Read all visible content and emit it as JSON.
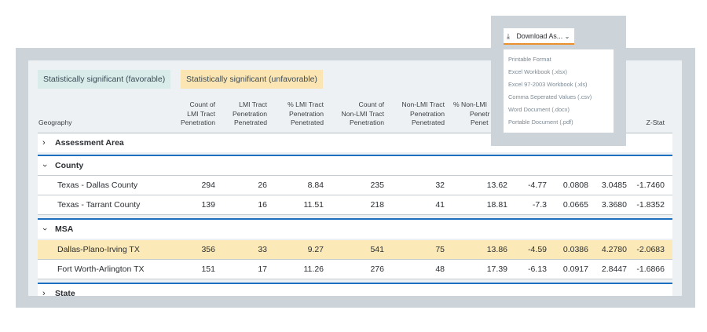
{
  "legend": {
    "favorable": "Statistically significant (favorable)",
    "unfavorable": "Statistically significant (unfavorable)"
  },
  "columns": {
    "geography": "Geography",
    "count_lmi": [
      "Count of",
      "LMI Tract",
      "Penetration"
    ],
    "lmi_penetrated": [
      "LMI Tract",
      "Penetration",
      "Penetrated"
    ],
    "pct_lmi": [
      "% LMI Tract",
      "Penetration",
      "Penetrated"
    ],
    "count_nonlmi": [
      "Count of",
      "Non-LMI Tract",
      "Penetration"
    ],
    "nonlmi_penetrated": [
      "Non-LMI Tract",
      "Penetration",
      "Penetrated"
    ],
    "pct_nonlmi": [
      "% Non-LMI",
      "Penetr",
      "Penet"
    ],
    "zstat": "Z-Stat"
  },
  "groups": {
    "assessment": "Assessment Area",
    "county": "County",
    "msa": "MSA",
    "state": "State"
  },
  "rows": {
    "dallas_county": [
      "Texas - Dallas County",
      "294",
      "26",
      "8.84",
      "235",
      "32",
      "13.62",
      "-4.77",
      "0.0808",
      "3.0485",
      "-1.7460"
    ],
    "tarrant_county": [
      "Texas - Tarrant County",
      "139",
      "16",
      "11.51",
      "218",
      "41",
      "18.81",
      "-7.3",
      "0.0665",
      "3.3680",
      "-1.8352"
    ],
    "dallas_msa": [
      "Dallas-Plano-Irving TX",
      "356",
      "33",
      "9.27",
      "541",
      "75",
      "13.86",
      "-4.59",
      "0.0386",
      "4.2780",
      "-2.0683"
    ],
    "fortworth_msa": [
      "Fort Worth-Arlington TX",
      "151",
      "17",
      "11.26",
      "276",
      "48",
      "17.39",
      "-6.13",
      "0.0917",
      "2.8447",
      "-1.6866"
    ]
  },
  "download": {
    "label": "Download As...",
    "items": [
      "Printable Format",
      "Excel Workbook (.xlsx)",
      "Excel 97-2003 Workbook (.xls)",
      "Comma Seperated Values (.csv)",
      "Word Document (.docx)",
      "Portable Document (.pdf)"
    ]
  },
  "icons": {
    "download": "download-icon",
    "chevron": "chevron-icon"
  },
  "colors": {
    "accent": "#e8912e",
    "rule_blue": "#1d6fc0",
    "favorable": "#d9ecea",
    "unfavorable": "#fbe6b3"
  }
}
